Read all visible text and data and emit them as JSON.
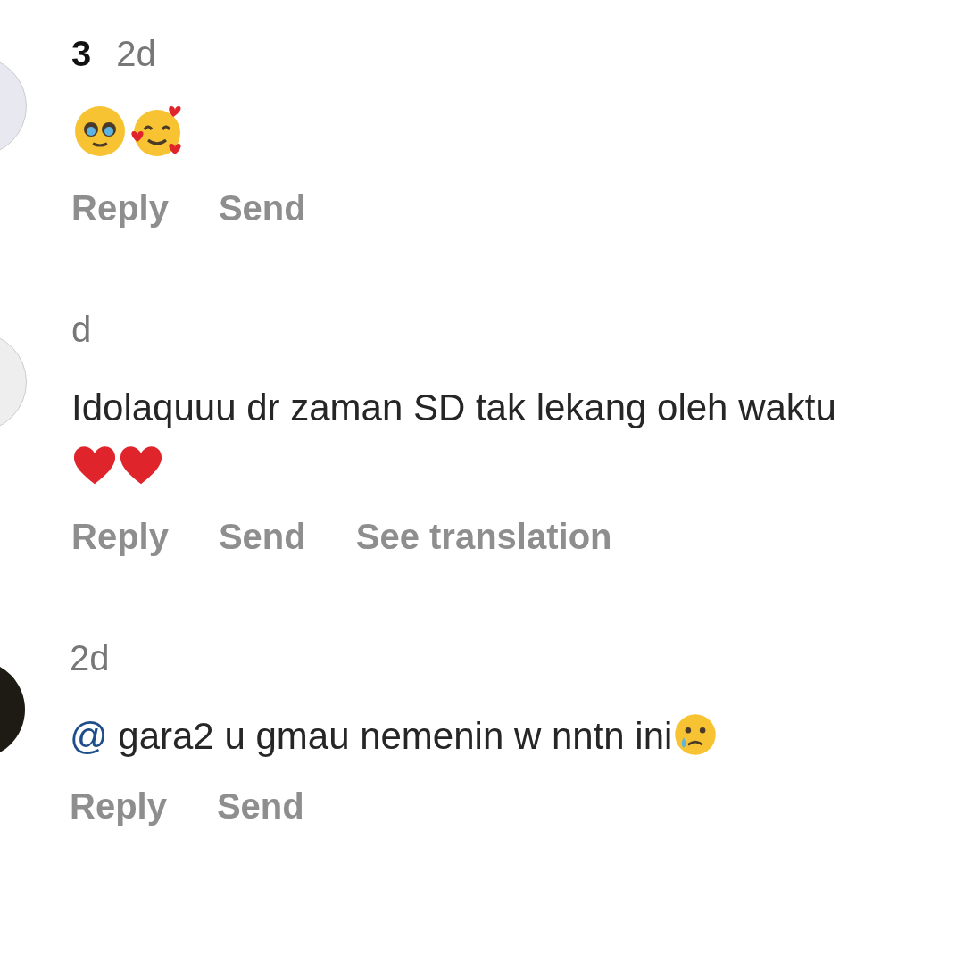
{
  "comments": [
    {
      "avatar": {
        "kind": "photo"
      },
      "username": "3",
      "time": "2d",
      "body": [
        {
          "kind": "pleading-emoji"
        },
        {
          "kind": "hearts-face-emoji"
        }
      ],
      "actions": [
        "Reply",
        "Send"
      ]
    },
    {
      "avatar": {
        "kind": "plain"
      },
      "time": "d",
      "body": [
        {
          "kind": "text",
          "text": "Idolaquuu dr zaman SD tak lekang oleh waktu"
        },
        {
          "kind": "heart-emoji"
        },
        {
          "kind": "heart-emoji"
        }
      ],
      "actions": [
        "Reply",
        "Send",
        "See translation"
      ]
    },
    {
      "avatar": {
        "kind": "dark-photo"
      },
      "time": "2d",
      "body": [
        {
          "kind": "mention",
          "text": "@"
        },
        {
          "kind": "text",
          "text": " gara2 u gmau nemenin w nntn ini"
        },
        {
          "kind": "crying-emoji"
        }
      ],
      "actions": [
        "Reply",
        "Send"
      ]
    }
  ]
}
